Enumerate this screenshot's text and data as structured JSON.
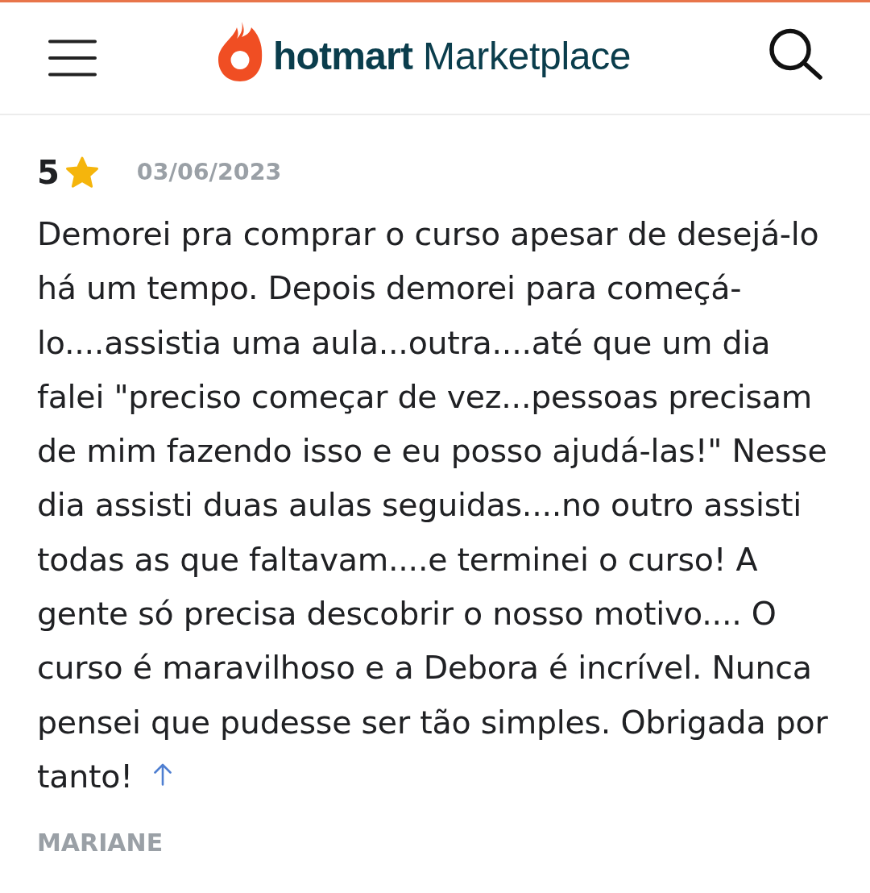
{
  "header": {
    "logo": {
      "brand": "hotmart",
      "product": "Marketplace"
    }
  },
  "review": {
    "rating": "5",
    "date": "03/06/2023",
    "text": "Demorei pra comprar o curso apesar de desejá-lo há um tempo. Depois demorei para começá-lo....assistia uma aula...outra....até que um dia falei \"preciso começar de vez...pessoas precisam de mim fazendo isso e eu posso ajudá-las!\" Nesse dia assisti duas aulas seguidas....no outro assisti todas as que faltavam....e terminei o curso! A gente só precisa descobrir o nosso motivo.... O curso é maravilhoso e a Debora é incrível. Nunca pensei que pudesse ser tão simples. Obrigada por tanto!",
    "author": "MARIANE"
  }
}
